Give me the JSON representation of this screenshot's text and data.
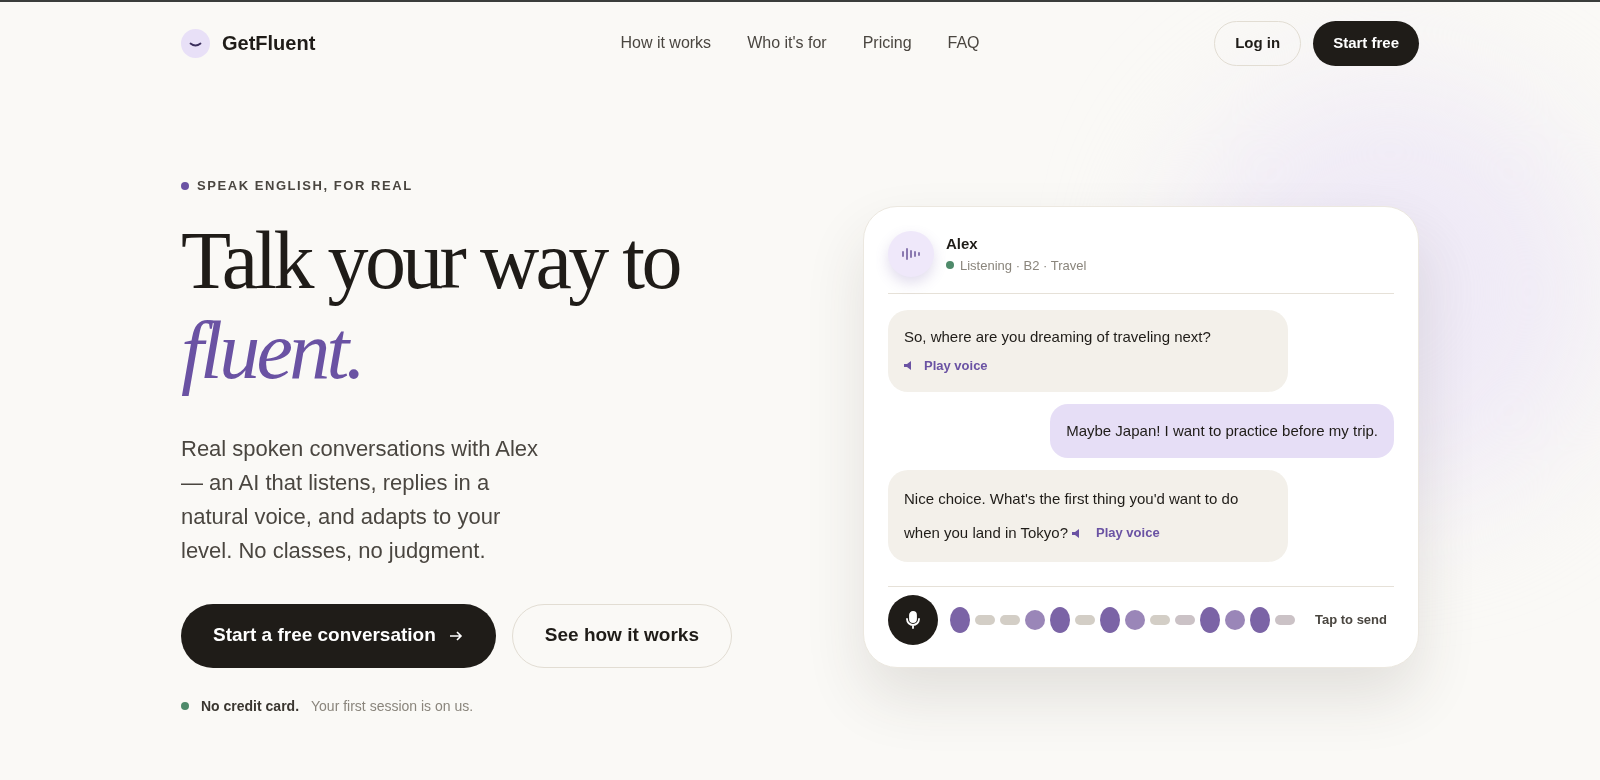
{
  "brand": {
    "name": "GetFluent"
  },
  "nav": [
    "How it works",
    "Who it's for",
    "Pricing",
    "FAQ"
  ],
  "header_buttons": [
    {
      "label": "Log in",
      "kind": "outline"
    },
    {
      "label": "Start free",
      "kind": "solid"
    }
  ],
  "hero": {
    "eyebrow": "SPEAK ENGLISH, FOR REAL",
    "title_line": "Talk your way to",
    "title_accent": "fluent.",
    "description": "Real spoken conversations with Alex — an AI that listens, replies in a natural voice, and adapts to your level. No classes, no judgment.",
    "buttons": [
      {
        "label": "Start a free conversation",
        "kind": "solid"
      },
      {
        "label": "See how it works",
        "kind": "outline"
      }
    ],
    "note": {
      "bold": "No credit card.",
      "text": "Your first session is on us."
    }
  },
  "chat": {
    "agent": {
      "name": "Alex",
      "status": "Listening · B2 · Travel"
    },
    "messages": [
      {
        "kind": "agent",
        "text": "So, where are you dreaming of traveling next?",
        "play": "Play voice"
      },
      {
        "kind": "user",
        "text": "Maybe Japan! I want to practice before my trip."
      },
      {
        "kind": "agent_inline",
        "lines": [
          "Nice choice. What's the first thing you'd want to do",
          "when you land in Tokyo?"
        ],
        "play": "Play voice"
      }
    ],
    "send_hint": "Tap to send"
  }
}
